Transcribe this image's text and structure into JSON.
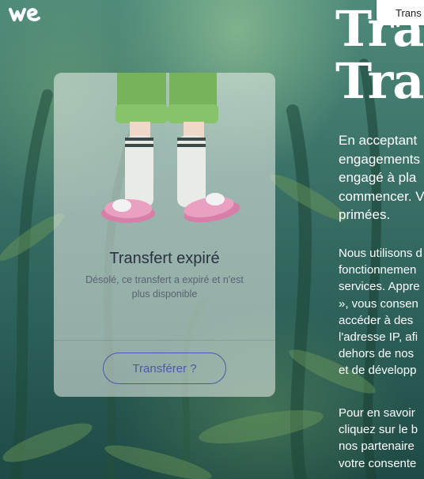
{
  "brand": {
    "logo_icon": "wetransfer-logo-icon"
  },
  "header": {
    "top_tab_label": "Trans"
  },
  "hero": {
    "title_line1": "Tra",
    "title_line2": "Tra"
  },
  "paragraphs": {
    "p1": [
      "En acceptant",
      "engagements",
      "engagé à pla",
      "commencer. V",
      "primées."
    ],
    "p2": [
      "Nous utilisons d",
      "fonctionnemen",
      "services. Appre",
      "», vous consen",
      "accéder à des",
      "l'adresse IP, afi",
      "dehors de nos",
      "et de développ"
    ],
    "p3": [
      "Pour en savoir",
      "cliquez sur le b",
      "nos partenaire",
      "votre consente"
    ]
  },
  "card": {
    "title": "Transfert expiré",
    "subtitle": "Désolé, ce transfert a expiré et n'est plus disponible",
    "button_label": "Transférer ?"
  },
  "colors": {
    "card_title": "#2b3140",
    "button_accent": "#4a5aa8",
    "hero_text": "#ffffff"
  }
}
